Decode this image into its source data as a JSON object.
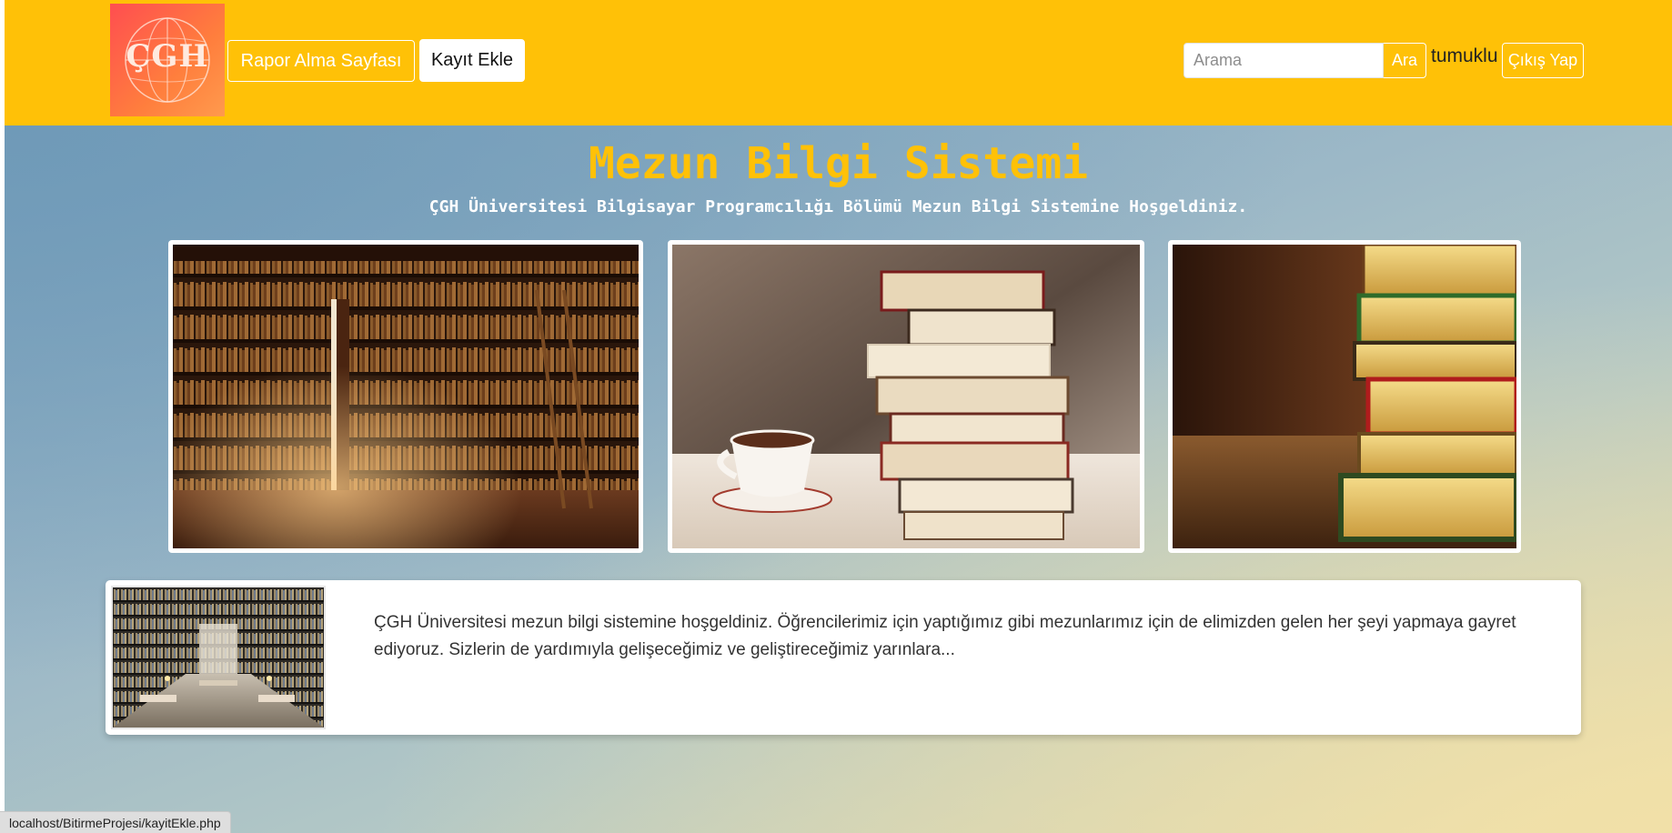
{
  "header": {
    "logo_text": "ÇGH",
    "report_button_label": "Rapor Alma Sayfası",
    "add_record_button_label": "Kayıt Ekle",
    "search_placeholder": "Arama",
    "search_value": "",
    "search_button_label": "Ara",
    "username": "tumuklu",
    "logout_button_label": "Çıkış Yap",
    "bar_color": "#ffc107"
  },
  "main": {
    "title": "Mezun Bilgi Sistemi",
    "subtitle": "ÇGH Üniversitesi Bilgisayar Programcılığı Bölümü Mezun Bilgi Sistemine Hoşgeldiniz.",
    "images": [
      {
        "name": "library-bookshelves-image",
        "icon": "library-photo"
      },
      {
        "name": "books-and-coffee-image",
        "icon": "books-coffee-photo"
      },
      {
        "name": "book-stack-image",
        "icon": "book-stack-photo"
      }
    ],
    "info_card": {
      "thumbnail": "library-hall-photo",
      "text": "ÇGH Üniversitesi mezun bilgi sistemine hoşgeldiniz. Öğrencilerimiz için yaptığımız gibi mezunlarımız için de elimizden gelen her şeyi yapmaya gayret ediyoruz. Sizlerin de yardımıyla gelişeceğimiz ve geliştireceğimiz yarınlara..."
    },
    "title_color": "#ffc107"
  },
  "status_bar": {
    "url": "localhost/BitirmeProjesi/kayitEkle.php"
  }
}
